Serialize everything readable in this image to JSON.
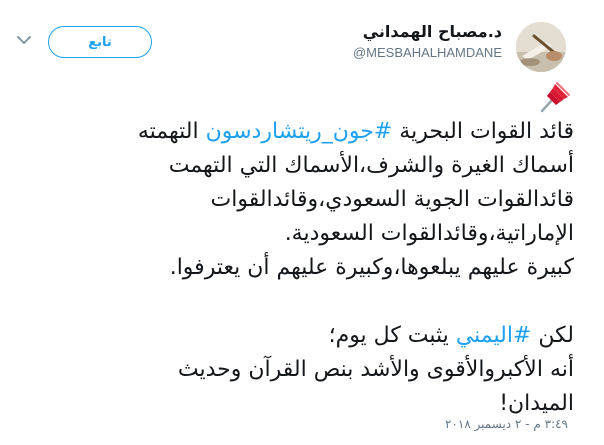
{
  "author": {
    "display_name": "د.مصباح الهمداني",
    "handle": "@MESBAHALHAMDANE"
  },
  "follow_label": "تابع",
  "pin_icon": "pushpin-icon",
  "tweet": {
    "l1_a": "قائد القوات البحرية ",
    "l1_hashtag": "#جون_ريتشاردسون",
    "l1_b": " التهمته",
    "l2": "أسماك الغيرة والشرف،الأسماك التي التهمت",
    "l3": "قائدالقوات الجوية السعودي،وقائدالقوات",
    "l4": "الإماراتية،وقائدالقوات السعودية.",
    "l5": "كبيرة عليهم يبلعوها،وكبيرة عليهم أن يعترفوا.",
    "l6_a": "لكن ",
    "l6_hashtag": "#اليمني",
    "l6_b": " يثبت كل يوم؛",
    "l7": "أنه الأكبروالأقوى والأشد بنص القرآن وحديث",
    "l8": "الميدان!"
  },
  "timestamp": "٣:٤٩ م - ٢ ديسمبر ٢٠١٨",
  "colors": {
    "accent": "#1da1f2",
    "text": "#14171a",
    "secondary": "#657786"
  }
}
